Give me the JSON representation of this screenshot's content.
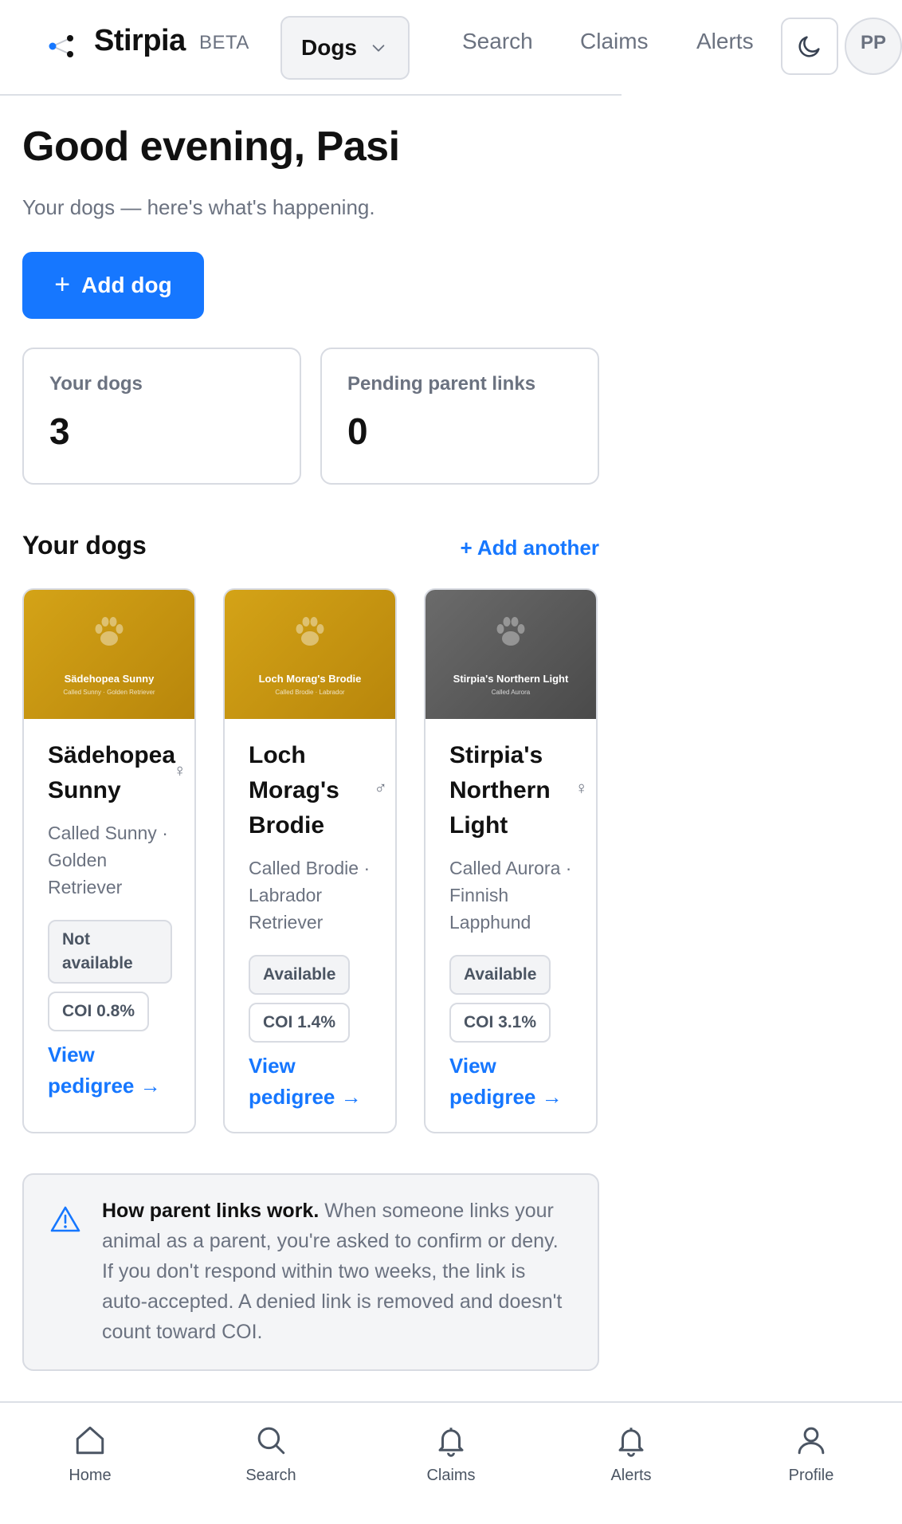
{
  "header": {
    "brand": "Stirpia",
    "badge": "BETA",
    "section_select": "Dogs",
    "nav": [
      "Search",
      "Claims",
      "Alerts"
    ],
    "avatar_initials": "PP"
  },
  "greeting": {
    "title": "Good evening, Pasi",
    "subtitle": "Your dogs — here's what's happening.",
    "add_button": "Add dog"
  },
  "stats": [
    {
      "label": "Your dogs",
      "value": "3"
    },
    {
      "label": "Pending parent links",
      "value": "0"
    }
  ],
  "dogs_section": {
    "title": "Your dogs",
    "add_another": "+ Add another",
    "dogs": [
      {
        "banner_name": "Sädehopea Sunny",
        "banner_sub": "Called Sunny · Golden Retriever",
        "name": "Sädehopea Sunny",
        "sex": "♀",
        "description": "Called Sunny · Golden Retriever",
        "status": "Not available",
        "coi": "COI 0.8%",
        "link": "View pedigree →"
      },
      {
        "banner_name": "Loch Morag's Brodie",
        "banner_sub": "Called Brodie · Labrador",
        "name": "Loch Morag's Brodie",
        "sex": "♂",
        "description": "Called Brodie · Labrador Retriever",
        "status": "Available",
        "coi": "COI 1.4%",
        "link": "View pedigree →"
      },
      {
        "banner_name": "Stirpia's Northern Light",
        "banner_sub": "Called Aurora",
        "name": "Stirpia's Northern Light",
        "sex": "♀",
        "description": "Called Aurora · Finnish Lapphund",
        "status": "Available",
        "coi": "COI 3.1%",
        "link": "View pedigree →"
      }
    ]
  },
  "info": {
    "heading": "How parent links work.",
    "body": "When someone links your animal as a parent, you're asked to confirm or deny. If you don't respond within two weeks, the link is auto-accepted. A denied link is removed and doesn't count toward COI."
  },
  "bottom_nav": [
    {
      "label": "Home",
      "icon": "home-icon"
    },
    {
      "label": "Search",
      "icon": "search-icon"
    },
    {
      "label": "Claims",
      "icon": "bell-icon"
    },
    {
      "label": "Alerts",
      "icon": "bell-icon"
    },
    {
      "label": "Profile",
      "icon": "person-icon"
    }
  ],
  "colors": {
    "accent": "#1677ff",
    "muted_text": "#6b7280",
    "border": "#d8dbe2",
    "banner_gold": "#c99512",
    "banner_gray": "#5a5a5a"
  }
}
